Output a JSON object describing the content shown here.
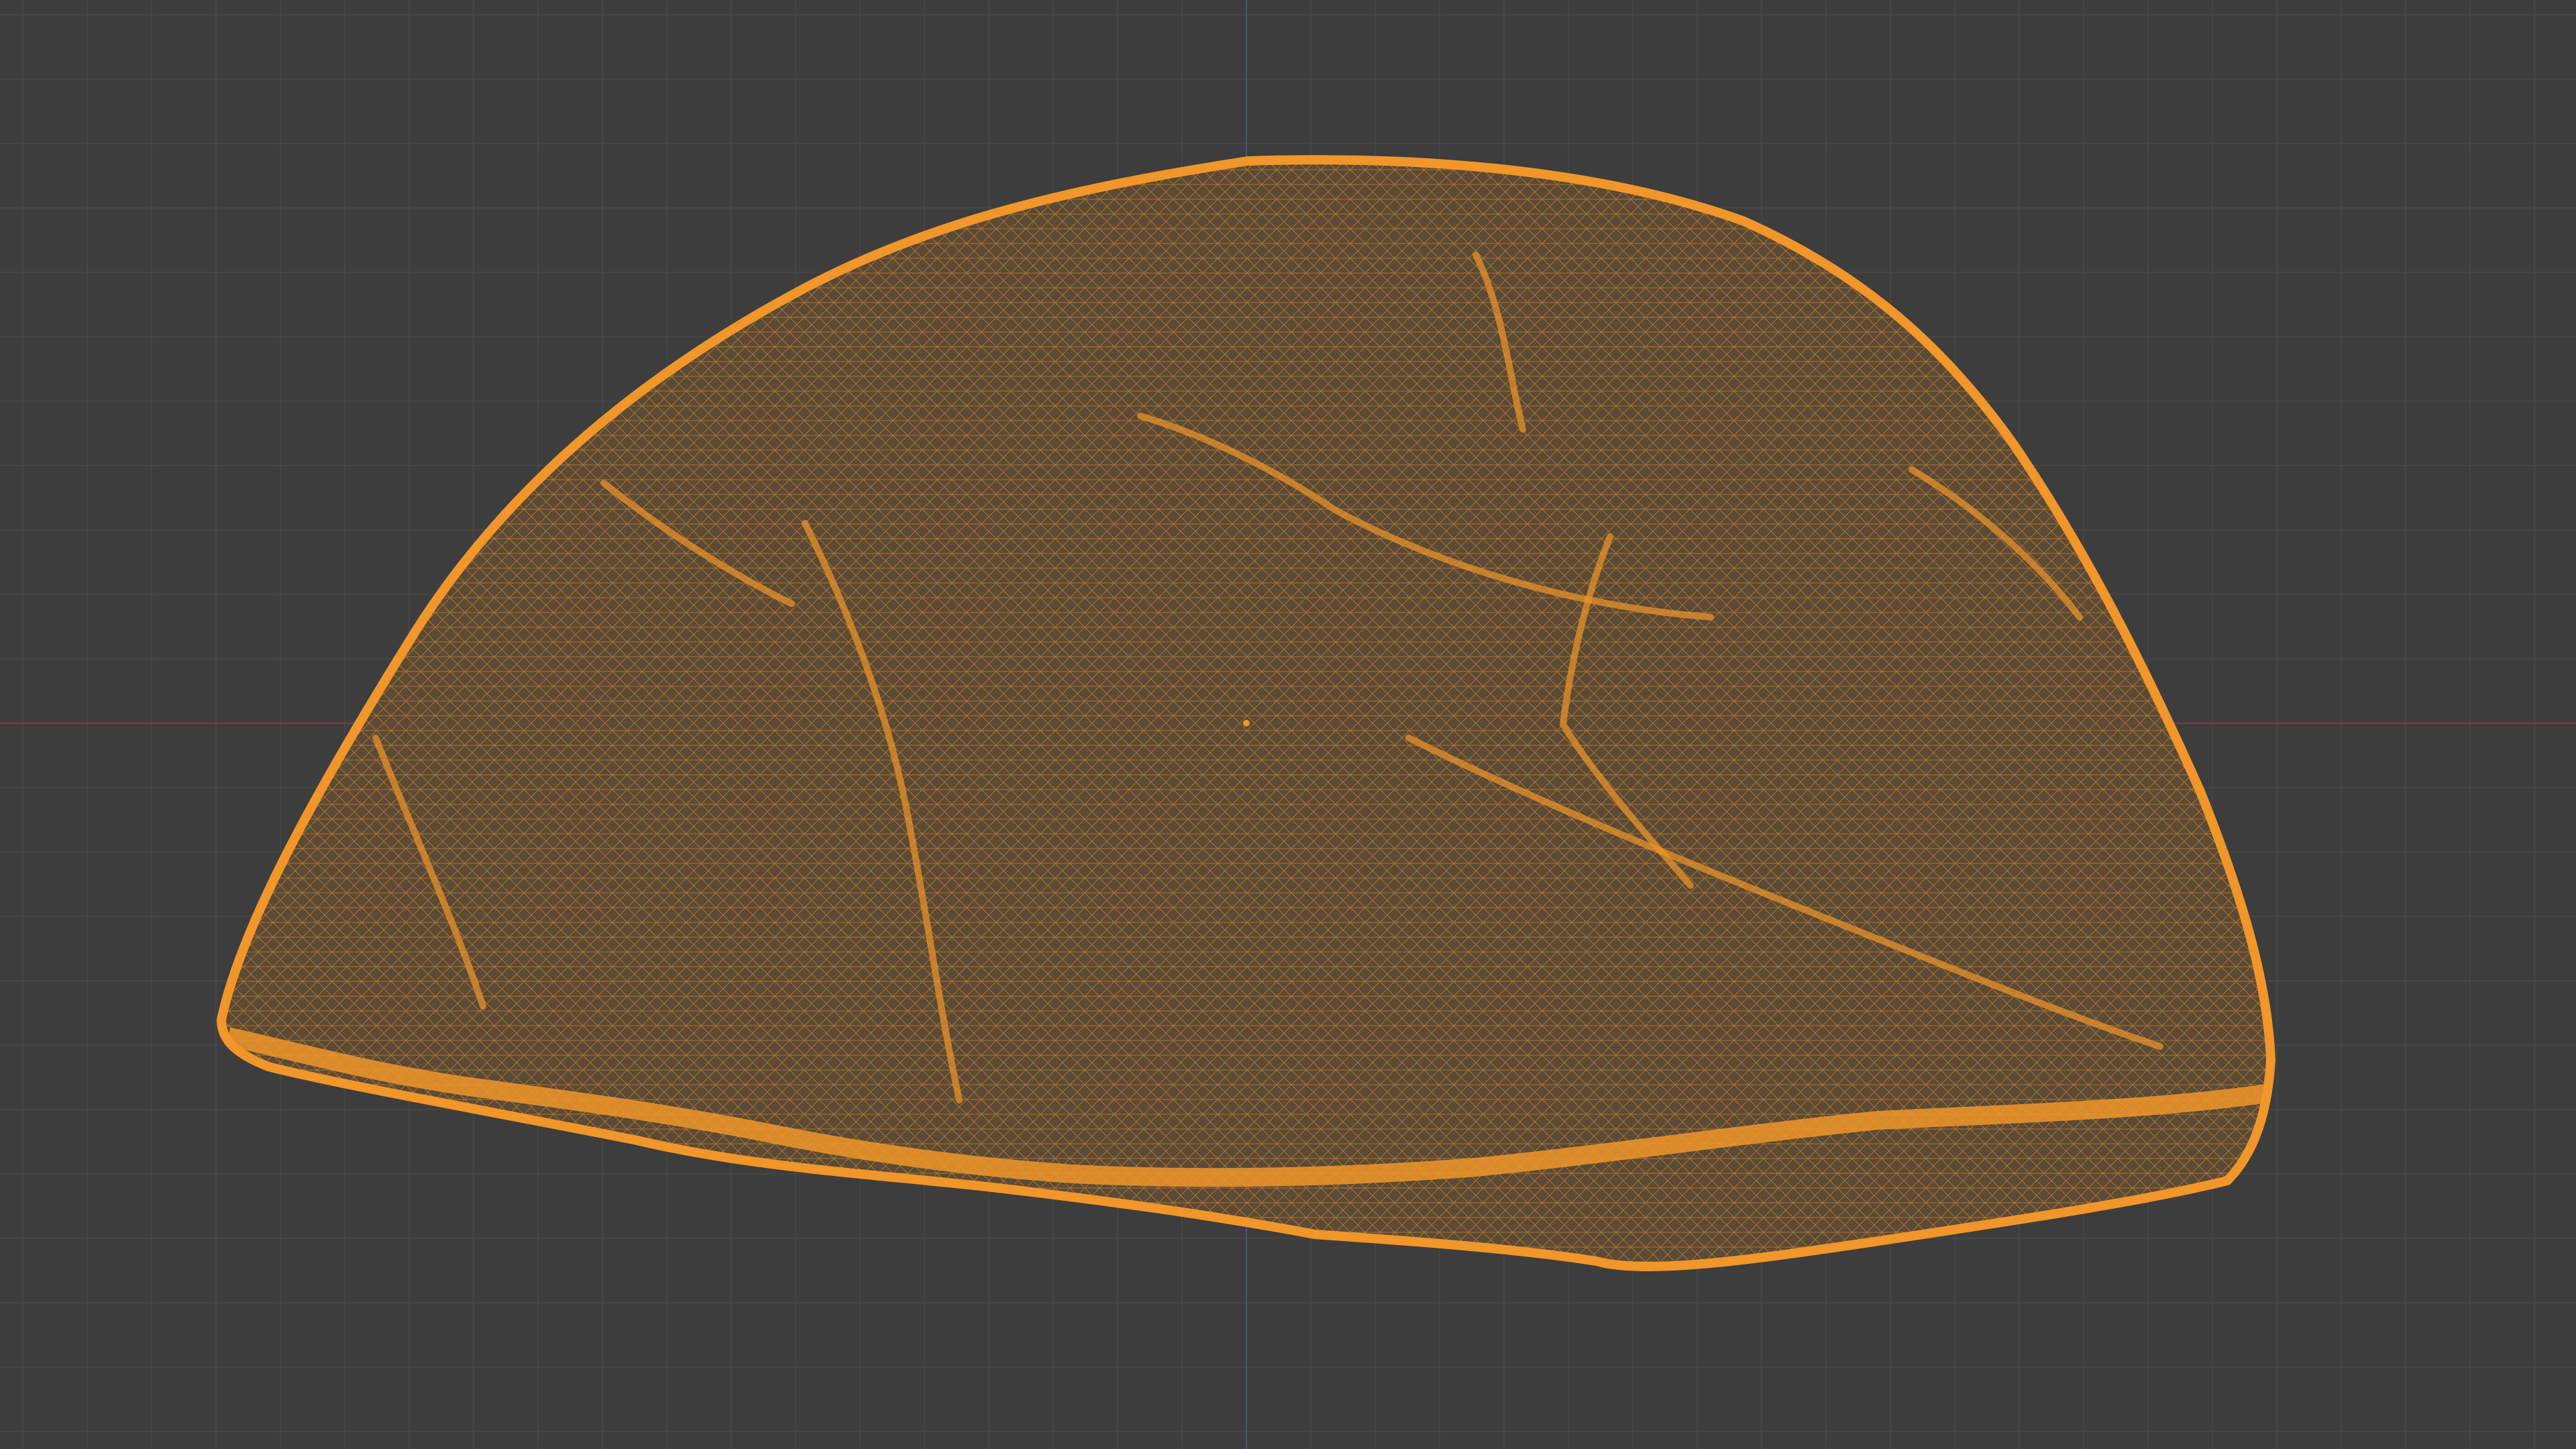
{
  "viewport": {
    "background_color": "#3d3d3d",
    "grid_minor_color": "#454545",
    "grid_major_color": "#4a4a4a",
    "x_axis_color": "#8a3a44",
    "y_axis_color": "#3a5a86"
  },
  "object": {
    "display_mode": "wireframe",
    "wire_color": "#f0962a",
    "fill_color": "#5a4a36"
  }
}
